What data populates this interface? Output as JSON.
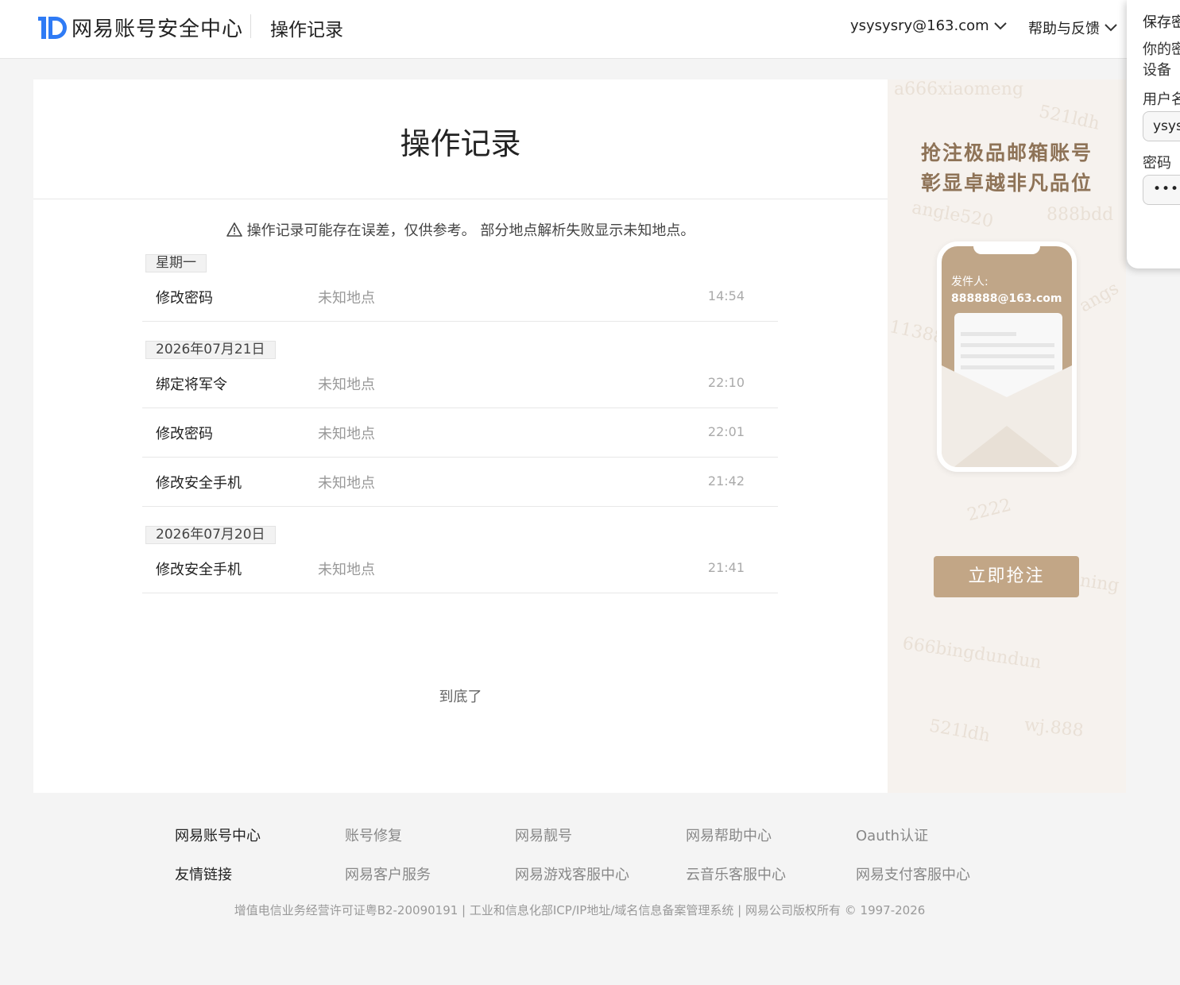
{
  "header": {
    "logo_text": "网易账号安全中心",
    "subtitle": "操作记录",
    "user": "ysysysry@163.com",
    "help": "帮助与反馈"
  },
  "card": {
    "title": "操作记录",
    "notice": "操作记录可能存在误差，仅供参考。 部分地点解析失败显示未知地点。",
    "bottom_note": "到底了"
  },
  "records": [
    {
      "date": "星期一",
      "items": [
        {
          "action": "修改密码",
          "location": "未知地点",
          "time": "14:54"
        }
      ]
    },
    {
      "date": "2026年07月21日",
      "items": [
        {
          "action": "绑定将军令",
          "location": "未知地点",
          "time": "22:10"
        },
        {
          "action": "修改密码",
          "location": "未知地点",
          "time": "22:01"
        },
        {
          "action": "修改安全手机",
          "location": "未知地点",
          "time": "21:42"
        }
      ]
    },
    {
      "date": "2026年07月20日",
      "items": [
        {
          "action": "修改安全手机",
          "location": "未知地点",
          "time": "21:41"
        }
      ]
    }
  ],
  "ad": {
    "line1": "抢注极品邮箱账号",
    "line2": "彰显卓越非凡品位",
    "sender_label": "发件人:",
    "sender_email": "888888@163.com",
    "button": "立即抢注",
    "watermarks": [
      "a666xiaomeng",
      "521ldh",
      "angle520",
      "888bdd",
      "angs",
      "11388",
      "2222",
      "ning",
      "666bingdundun",
      "521ldh",
      "wj.888"
    ]
  },
  "popup": {
    "title": "保存密",
    "desc_line1": "你的密",
    "desc_line2": "设备",
    "username_label": "用户名",
    "username_value": "ysysy",
    "password_label": "密码",
    "password_value": "••••••"
  },
  "footer": {
    "row1_head": "网易账号中心",
    "row1_links": [
      "账号修复",
      "网易靓号",
      "网易帮助中心",
      "Oauth认证"
    ],
    "row2_head": "友情链接",
    "row2_links": [
      "网易客户服务",
      "网易游戏客服中心",
      "云音乐客服中心",
      "网易支付客服中心"
    ],
    "copyright": "增值电信业务经营许可证粤B2-20090191 |  工业和信息化部ICP/IP地址/域名信息备案管理系统 |  网易公司版权所有  © 1997-2026"
  },
  "colors": {
    "brand_blue": "#2f7bf5",
    "ad_gold": "#c2a686",
    "ad_text": "#8e7357"
  }
}
